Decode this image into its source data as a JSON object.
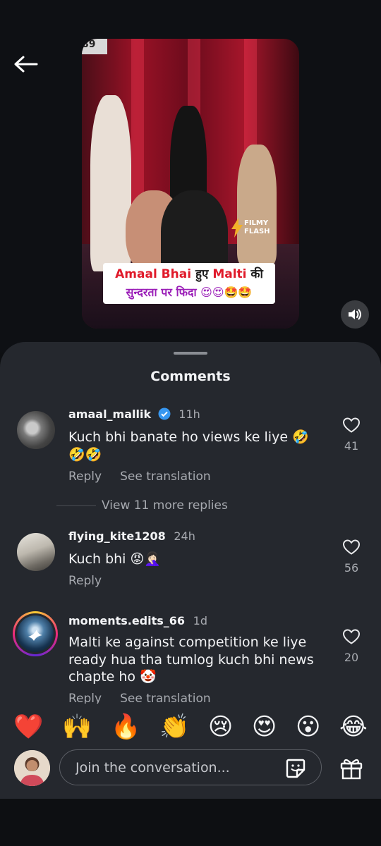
{
  "video": {
    "logo_text": "89",
    "badge_text": "FILMY FLASH",
    "caption_part1": "Amaal Bhai",
    "caption_part2": " हुए ",
    "caption_part3": "Malti",
    "caption_part4": " की",
    "caption_line2": "सुन्दरता पर फिदा 😍😍🤩🤩"
  },
  "comments_title": "Comments",
  "comments": [
    {
      "username": "amaal_mallik",
      "verified": true,
      "time": "11h",
      "text": "Kuch bhi banate ho views ke liye 🤣🤣🤣",
      "reply_label": "Reply",
      "translate_label": "See translation",
      "likes": "41"
    },
    {
      "username": "flying_kite1208",
      "time": "24h",
      "text": "Kuch bhi 😡🤦🏻‍♀️",
      "reply_label": "Reply",
      "likes": "56"
    },
    {
      "username": "moments.edits_66",
      "time": "1d",
      "text": "Malti ke against competition ke liye ready hua tha tumlog kuch bhi news chapte ho 🤡",
      "reply_label": "Reply",
      "translate_label": "See translation",
      "likes": "20"
    }
  ],
  "view_more_replies": "View 11 more replies",
  "emoji_bar": [
    "❤️",
    "🙌",
    "🔥",
    "👏",
    "😢",
    "😍",
    "😮",
    "😂"
  ],
  "input": {
    "placeholder": "Join the conversation..."
  },
  "colors": {
    "sheet_bg": "#25282e",
    "verified": "#3797f0",
    "muted_text": "#a7aab0"
  }
}
